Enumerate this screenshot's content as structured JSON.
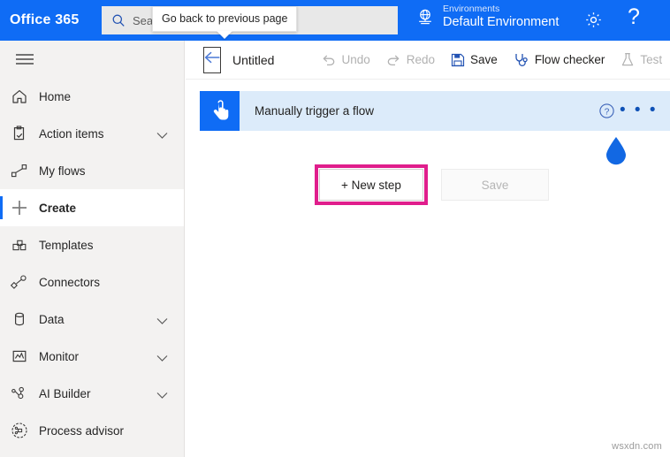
{
  "header": {
    "brand": "Office 365",
    "search": {
      "icon": "search-icon",
      "placeholder": "Search all flows"
    },
    "environment": {
      "icon": "environment-globe-icon",
      "label": "Environments",
      "name": "Default Environment"
    },
    "settings_icon": "gear-icon",
    "help_icon": "question-mark-icon",
    "help_glyph": "?"
  },
  "tooltip": {
    "text": "Go back to previous page"
  },
  "sidebar": {
    "menu_icon": "hamburger-menu-icon",
    "items": [
      {
        "label": "Home",
        "icon": "home-icon",
        "chevron": false,
        "selected": false
      },
      {
        "label": "Action items",
        "icon": "clipboard-check-icon",
        "chevron": true,
        "selected": false
      },
      {
        "label": "My flows",
        "icon": "flow-nodes-icon",
        "chevron": false,
        "selected": false
      },
      {
        "label": "Create",
        "icon": "plus-icon",
        "chevron": false,
        "selected": true
      },
      {
        "label": "Templates",
        "icon": "templates-icon",
        "chevron": false,
        "selected": false
      },
      {
        "label": "Connectors",
        "icon": "connector-plug-icon",
        "chevron": false,
        "selected": false
      },
      {
        "label": "Data",
        "icon": "database-icon",
        "chevron": true,
        "selected": false
      },
      {
        "label": "Monitor",
        "icon": "monitor-chart-icon",
        "chevron": true,
        "selected": false
      },
      {
        "label": "AI Builder",
        "icon": "ai-builder-icon",
        "chevron": true,
        "selected": false
      },
      {
        "label": "Process advisor",
        "icon": "process-advisor-icon",
        "chevron": false,
        "selected": false
      }
    ]
  },
  "command_bar": {
    "back_button": {
      "icon": "back-arrow-icon",
      "focused": true
    },
    "flow_title": "Untitled",
    "buttons": [
      {
        "label": "Undo",
        "icon": "undo-arrow-icon",
        "enabled": false
      },
      {
        "label": "Redo",
        "icon": "redo-arrow-icon",
        "enabled": false
      },
      {
        "label": "Save",
        "icon": "save-disk-icon",
        "enabled": true
      },
      {
        "label": "Flow checker",
        "icon": "stethoscope-icon",
        "enabled": true
      },
      {
        "label": "Test",
        "icon": "flask-icon",
        "enabled": false
      }
    ]
  },
  "canvas": {
    "trigger_card": {
      "icon": "touch-hand-icon",
      "title": "Manually trigger a flow",
      "help_icon": "help-circle-icon",
      "more_icon": "ellipsis-icon",
      "more_glyph": "• • •"
    },
    "cursor": {
      "icon": "blue-drop-cursor-icon"
    },
    "new_step_button": {
      "label": "+ New step",
      "highlighted": true
    },
    "save_button": {
      "label": "Save",
      "enabled": false
    }
  },
  "watermark": "wsxdn.com",
  "colors": {
    "header_blue": "#0f6cf5",
    "accent_blue": "#0f6cf5",
    "highlight_pink": "#e01e8c",
    "card_blue": "#dcebfa",
    "sidebar_gray": "#f3f2f1"
  }
}
